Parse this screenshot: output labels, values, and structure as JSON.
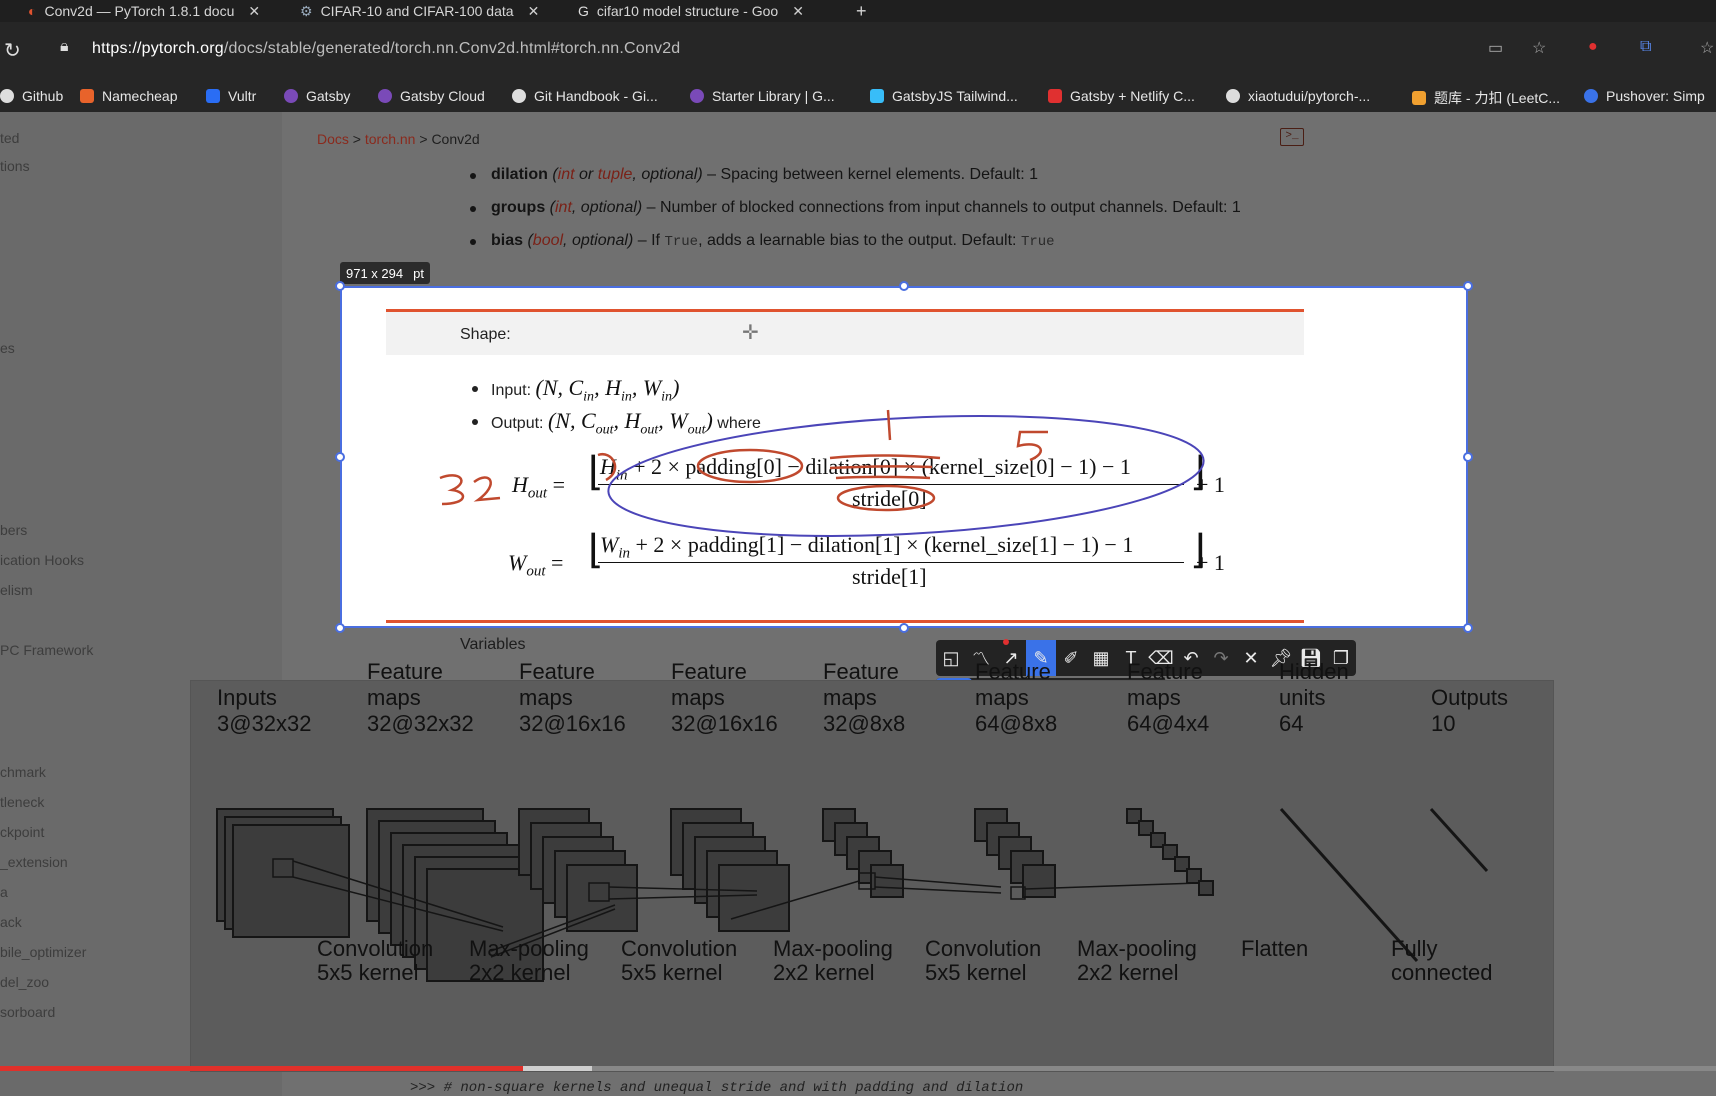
{
  "tabs": [
    {
      "title": "Conv2d — PyTorch 1.8.1 docu"
    },
    {
      "title": "CIFAR-10 and CIFAR-100 data"
    },
    {
      "title": "cifar10 model structure - Goo"
    }
  ],
  "address": {
    "host": "https://pytorch.org",
    "path": "/docs/stable/generated/torch.nn.Conv2d.html#torch.nn.Conv2d"
  },
  "bookmarks": [
    "Github",
    "Namecheap",
    "Vultr",
    "Gatsby",
    "Gatsby Cloud",
    "Git Handbook - Gi...",
    "Starter Library | G...",
    "GatsbyJS Tailwind...",
    "Gatsby + Netlify C...",
    "xiaotudui/pytorch-...",
    "题库 - 力扣 (LeetC...",
    "Pushover: Simp"
  ],
  "sidebar": {
    "items": [
      "ted",
      "tions",
      "es",
      "bers",
      "ication Hooks",
      "elism",
      "PC Framework",
      "chmark",
      "tleneck",
      "ckpoint",
      "_extension",
      "a",
      "ack",
      "bile_optimizer",
      "del_zoo",
      "sorboard"
    ]
  },
  "breadcrumb": {
    "docs": "Docs",
    "sep": ">",
    "nn": "torch.nn",
    "current": "Conv2d"
  },
  "params": {
    "dilation": {
      "name": "dilation",
      "open": "(",
      "t1": "int",
      "or": "or",
      "t2": "tuple",
      "opt": ", optional)",
      "desc": "– Spacing between kernel elements. Default: 1"
    },
    "groups": {
      "name": "groups",
      "open": "(",
      "t1": "int",
      "opt": ", optional)",
      "desc": "– Number of blocked connections from input channels to output channels. Default: 1"
    },
    "bias": {
      "name": "bias",
      "open": "(",
      "t1": "bool",
      "opt": ", optional)",
      "desc1": "– If",
      "code1": "True",
      "desc2": ", adds a learnable bias to the output. Default:",
      "code2": "True"
    }
  },
  "selection": {
    "size": "971 x 294",
    "unit": "pt"
  },
  "shape": {
    "heading": "Shape:",
    "input_label": "Input:",
    "input_math": "(N, C",
    "output_label": "Output:",
    "output_where": "where",
    "h_eq": {
      "lhs": "H",
      "lhs_sub": "out",
      "num": "H",
      "num_sub": "in",
      "num_rest": " + 2 × padding[0] − dilation[0] × (kernel_size[0] − 1) − 1",
      "den": "stride[0]",
      "plus": "+ 1"
    },
    "w_eq": {
      "lhs": "W",
      "lhs_sub": "out",
      "num": "W",
      "num_sub": "in",
      "num_rest": " + 2 × padding[1] − dilation[1] × (kernel_size[1] − 1) − 1",
      "den": "stride[1]",
      "plus": "+ 1"
    },
    "annotations": {
      "a32": "32",
      "one": "1",
      "five": "5"
    }
  },
  "variables_label": "Variables",
  "toolbar": {
    "tools": [
      "shape-tool",
      "polyline-tool",
      "arrow-tool",
      "pen-tool",
      "marker-tool",
      "mosaic-tool",
      "text-tool",
      "eraser-tool",
      "undo",
      "redo",
      "close",
      "pin",
      "save",
      "copy"
    ],
    "active": "pen-tool",
    "text_glyph": "T"
  },
  "palette": {
    "current": "#8b1a1a",
    "colors": [
      "#000000",
      "#7a7a7a",
      "#8b1a1a",
      "#e03030",
      "#e07a30",
      "#e0c030",
      "#40b040",
      "#3090e0",
      "#3050c0",
      "#a050c0",
      "#ffffff",
      "#bbbbbb",
      "#b06060",
      "#f0a0a0",
      "#f0c090",
      "#f0e090",
      "#a0e0a0",
      "#a0d0f0",
      "#a0a0f0",
      "#d0a0e0"
    ]
  },
  "cnn": {
    "top_labels": [
      {
        "l1": "",
        "l2": "Inputs",
        "l3": "3@32x32"
      },
      {
        "l1": "Feature",
        "l2": "maps",
        "l3": "32@32x32"
      },
      {
        "l1": "Feature",
        "l2": "maps",
        "l3": "32@16x16"
      },
      {
        "l1": "Feature",
        "l2": "maps",
        "l3": "32@16x16"
      },
      {
        "l1": "Feature",
        "l2": "maps",
        "l3": "32@8x8"
      },
      {
        "l1": "Feature",
        "l2": "maps",
        "l3": "64@8x8"
      },
      {
        "l1": "Feature",
        "l2": "maps",
        "l3": "64@4x4"
      },
      {
        "l1": "Hidden",
        "l2": "units",
        "l3": "64"
      },
      {
        "l1": "",
        "l2": "Outputs",
        "l3": "10"
      }
    ],
    "bottom_labels": [
      {
        "l1": "Convolution",
        "l2": "5x5 kernel"
      },
      {
        "l1": "Max-pooling",
        "l2": "2x2 kernel"
      },
      {
        "l1": "Convolution",
        "l2": "5x5 kernel"
      },
      {
        "l1": "Max-pooling",
        "l2": "2x2 kernel"
      },
      {
        "l1": "Convolution",
        "l2": "5x5 kernel"
      },
      {
        "l1": "Max-pooling",
        "l2": "2x2 kernel"
      },
      {
        "l1": "Flatten",
        "l2": ""
      },
      {
        "l1": "Fully",
        "l2": "connected"
      }
    ]
  },
  "video": {
    "progress": 0.305,
    "buffered": 0.345
  },
  "code_peek": ">>> # non-square kernels and unequal stride and with padding and dilation"
}
